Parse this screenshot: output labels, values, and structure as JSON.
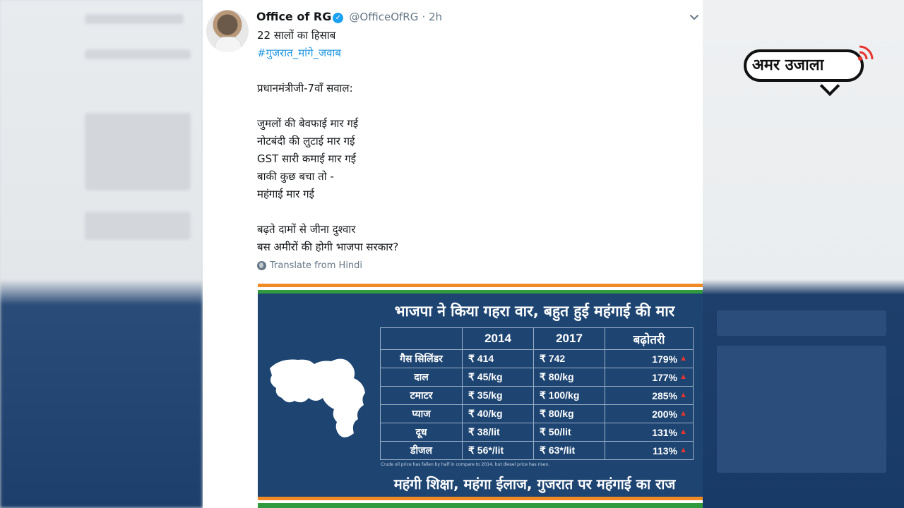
{
  "tweet": {
    "display_name": "Office of RG",
    "handle": "@OfficeOfRG",
    "time": "· 2h",
    "lines": [
      "22 सालों का हिसाब",
      "#गुजरात_मांगे_जवाब",
      "",
      "प्रधानमंत्रीजी-7वाँ सवाल:",
      "",
      "जुमलों की बेवफाई मार गई",
      "नोटबंदी की लुटाई मार गई",
      "GST सारी कमाई मार गई",
      "बाकी कुछ बचा तो -",
      "महंगाई मार गई",
      "",
      "बढ़ते दामों से जीना दुश्वार",
      "बस अमीरों की होगी भाजपा सरकार?"
    ],
    "translate_label": "Translate from Hindi"
  },
  "infographic": {
    "title": "भाजपा ने किया गहरा वार, बहुत हुई महंगाई की मार",
    "table": {
      "headers": [
        "",
        "2014",
        "2017",
        "बढ़ोतरी"
      ],
      "rows": [
        [
          "गैस सिलिंडर",
          "₹  414",
          "₹  742",
          "179%"
        ],
        [
          "दाल",
          "₹  45/kg",
          "₹  80/kg",
          "177%"
        ],
        [
          "टमाटर",
          "₹  35/kg",
          "₹  100/kg",
          "285%"
        ],
        [
          "प्याज",
          "₹  40/kg",
          "₹  80/kg",
          "200%"
        ],
        [
          "दूध",
          "₹  38/lit",
          "₹  50/lit",
          "131%"
        ],
        [
          "डीजल",
          "₹  56*/lit",
          "₹  63*/lit",
          "113%"
        ]
      ]
    },
    "footnote": "Crude oil price has fallen by half in compare to 2014, but diesel price has risen.",
    "bottom_line": "महंगी  शिक्षा, महंगा  ईलाज, गुजरात पर महंगाई का राज"
  },
  "logo": {
    "text": "अमर उजाला"
  },
  "colors": {
    "link": "#1b95e0",
    "verified": "#1da1f2",
    "infographic_bg": "#1e4572",
    "saffron": "#f08a24",
    "green": "#2f9a3e",
    "increase_arrow": "#e8342d"
  },
  "icons": [
    "verified-badge-icon",
    "chevron-down-icon",
    "globe-icon",
    "gujarat-map-icon",
    "signal-icon"
  ]
}
